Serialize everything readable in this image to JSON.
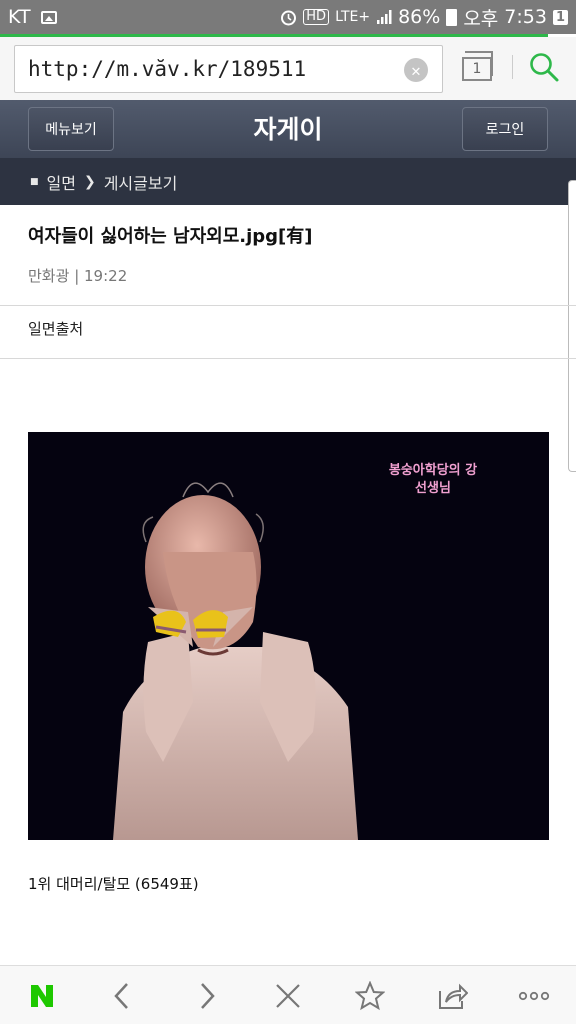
{
  "status_bar": {
    "carrier": "KT",
    "battery": "86%",
    "ampm": "오후",
    "time": "7:53",
    "notification_count": "1",
    "hd": "HD",
    "network": "LTE+"
  },
  "browser": {
    "url": "http://m.văv.kr/189511",
    "tab_count": "1"
  },
  "site": {
    "title": "자게이",
    "menu_label": "메뉴보기",
    "login_label": "로그인"
  },
  "breadcrumb": {
    "section": "일면",
    "page": "게시글보기"
  },
  "post": {
    "title": "여자들이 싫어하는 남자외모.jpg[有]",
    "author": "만화광",
    "time": "19:22",
    "source": "일면출처",
    "image_overlay": "봉숭아학당의 강선생님",
    "caption": "1위 대머리/탈모 (6549표)"
  },
  "colors": {
    "accent_green": "#2eb84a",
    "header_bg": "#434b5c",
    "breadcrumb_bg": "#2d3341"
  }
}
